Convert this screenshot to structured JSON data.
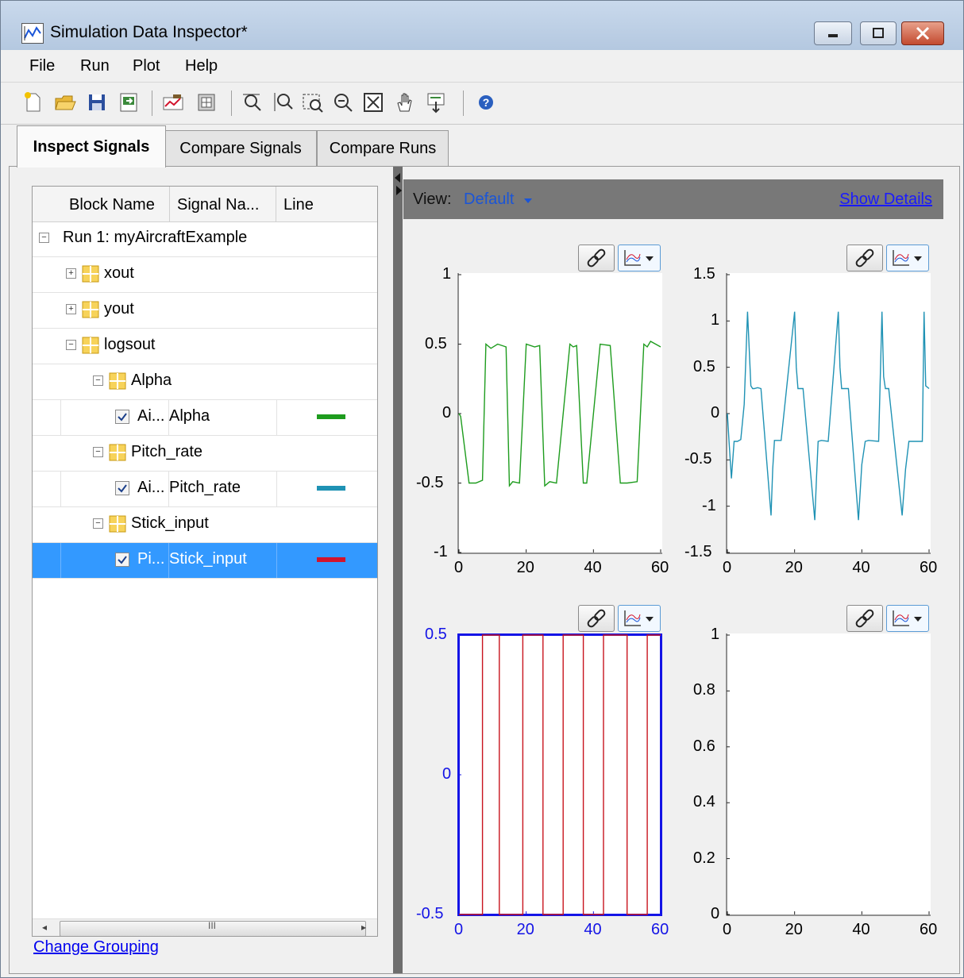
{
  "window": {
    "title": "Simulation Data Inspector*"
  },
  "menu": [
    "File",
    "Run",
    "Plot",
    "Help"
  ],
  "toolbar_icons": [
    "new-icon",
    "open-icon",
    "save-icon",
    "import-icon",
    "report-icon",
    "archive-icon",
    "zoom-time-icon",
    "zoom-y-icon",
    "zoom-in-icon",
    "zoom-out-icon",
    "fit-to-view-icon",
    "pan-icon",
    "data-cursor-icon",
    "help-icon"
  ],
  "tabs": [
    "Inspect Signals",
    "Compare Signals",
    "Compare Runs"
  ],
  "tree": {
    "columns": [
      "Block Name",
      "Signal Na...",
      "Line"
    ],
    "rows": [
      {
        "indent": 0,
        "expander": "−",
        "icon": false,
        "check": false,
        "text": "Run 1: myAircraftExample"
      },
      {
        "indent": 1,
        "expander": "+",
        "icon": true,
        "check": false,
        "text": "xout"
      },
      {
        "indent": 1,
        "expander": "+",
        "icon": true,
        "check": false,
        "text": "yout"
      },
      {
        "indent": 1,
        "expander": "−",
        "icon": true,
        "check": false,
        "text": "logsout"
      },
      {
        "indent": 2,
        "expander": "−",
        "icon": true,
        "check": false,
        "text": "Alpha"
      },
      {
        "indent": 3,
        "expander": "",
        "icon": false,
        "check": true,
        "block": "Ai...",
        "signal": "Alpha",
        "line": "#1e9c1e"
      },
      {
        "indent": 2,
        "expander": "−",
        "icon": true,
        "check": false,
        "text": "Pitch_rate"
      },
      {
        "indent": 3,
        "expander": "",
        "icon": false,
        "check": true,
        "block": "Ai...",
        "signal": "Pitch_rate",
        "line": "#1f92b4"
      },
      {
        "indent": 2,
        "expander": "−",
        "icon": true,
        "check": false,
        "text": "Stick_input"
      },
      {
        "indent": 3,
        "expander": "",
        "icon": false,
        "check": true,
        "block": "Pi...",
        "signal": "Stick_input",
        "line": "#d2142d",
        "selected": true
      }
    ],
    "scroll_grip": "III"
  },
  "change_grouping": "Change Grouping",
  "view": {
    "label": "View:",
    "value": "Default",
    "show_details": "Show Details"
  },
  "colors": {
    "alpha": "#1e9c1e",
    "pitch_rate": "#1f92b4",
    "stick_input": "#c8141e",
    "selected_axes": "#1414e6",
    "selection": "#3399ff"
  },
  "chart_data": [
    {
      "type": "line",
      "series": [
        {
          "signal": "Alpha",
          "color": "#1e9c1e",
          "x": [
            0,
            0.5,
            3,
            5,
            7,
            8,
            9.5,
            11.5,
            14,
            15,
            16,
            18,
            20,
            22.5,
            24,
            25.5,
            27,
            29,
            33,
            34,
            35,
            37,
            38,
            42,
            45,
            48,
            50,
            53,
            55,
            56,
            57,
            60
          ],
          "y": [
            0,
            -0.02,
            -0.5,
            -0.5,
            -0.48,
            0.5,
            0.47,
            0.5,
            0.48,
            -0.52,
            -0.49,
            -0.5,
            0.5,
            0.48,
            0.49,
            -0.52,
            -0.49,
            -0.5,
            0.5,
            0.48,
            0.49,
            -0.5,
            -0.5,
            0.5,
            0.49,
            -0.5,
            -0.5,
            -0.49,
            0.5,
            0.48,
            0.52,
            0.48
          ]
        }
      ],
      "xticks": [
        "0",
        "20",
        "40",
        "60"
      ],
      "yticks": [
        "1",
        "0.5",
        "0",
        "-0.5",
        "-1"
      ],
      "xlim": [
        0,
        60
      ],
      "ylim": [
        -1,
        1
      ]
    },
    {
      "type": "line",
      "series": [
        {
          "signal": "Pitch_rate",
          "color": "#1f92b4",
          "x": [
            0,
            0.5,
            1.2,
            2,
            3,
            4,
            5,
            6,
            7,
            7.5,
            8,
            9,
            10,
            13,
            13.5,
            14,
            15,
            16,
            20,
            20.5,
            21,
            22.5,
            26,
            26.5,
            27,
            28,
            30,
            33,
            33.5,
            34,
            35,
            36,
            39,
            40,
            41,
            42,
            45,
            46,
            46.5,
            47,
            48,
            52,
            53,
            54,
            55,
            58,
            58.5,
            59,
            60
          ],
          "y": [
            0,
            -0.3,
            -0.7,
            -0.3,
            -0.3,
            -0.28,
            0.1,
            1.1,
            0.3,
            0.27,
            0.27,
            0.28,
            0.27,
            -1.1,
            -0.6,
            -0.29,
            -0.29,
            -0.29,
            1.1,
            0.5,
            0.27,
            0.27,
            -1.15,
            -0.7,
            -0.3,
            -0.29,
            -0.3,
            1.1,
            0.5,
            0.27,
            0.27,
            0.27,
            -1.15,
            -0.55,
            -0.3,
            -0.29,
            -0.3,
            1.1,
            0.4,
            0.27,
            0.27,
            -1.1,
            -0.6,
            -0.3,
            -0.3,
            -0.3,
            1.1,
            0.3,
            0.27
          ]
        }
      ],
      "xticks": [
        "0",
        "20",
        "40",
        "60"
      ],
      "yticks": [
        "1.5",
        "1",
        "0.5",
        "0",
        "-0.5",
        "-1",
        "-1.5"
      ],
      "xlim": [
        0,
        60
      ],
      "ylim": [
        -1.5,
        1.5
      ]
    },
    {
      "type": "line",
      "selected": true,
      "series": [
        {
          "signal": "Stick_input",
          "color": "#c8141e",
          "x": [
            0,
            7,
            7,
            12,
            12,
            19,
            19,
            25,
            25,
            31,
            31,
            37,
            37,
            43,
            43,
            50,
            50,
            56,
            56,
            60
          ],
          "y": [
            -0.5,
            -0.5,
            0.5,
            0.5,
            -0.5,
            -0.5,
            0.5,
            0.5,
            -0.5,
            -0.5,
            0.5,
            0.5,
            -0.5,
            -0.5,
            0.5,
            0.5,
            -0.5,
            -0.5,
            0.5,
            0.5
          ]
        }
      ],
      "xticks": [
        "0",
        "20",
        "40",
        "60"
      ],
      "yticks": [
        "0.5",
        "0",
        "-0.5"
      ],
      "xlim": [
        0,
        60
      ],
      "ylim": [
        -0.5,
        0.5
      ]
    },
    {
      "type": "line",
      "series": [],
      "xticks": [
        "0",
        "20",
        "40",
        "60"
      ],
      "yticks": [
        "1",
        "0.8",
        "0.6",
        "0.4",
        "0.2",
        "0"
      ],
      "xlim": [
        0,
        60
      ],
      "ylim": [
        0,
        1
      ]
    }
  ]
}
